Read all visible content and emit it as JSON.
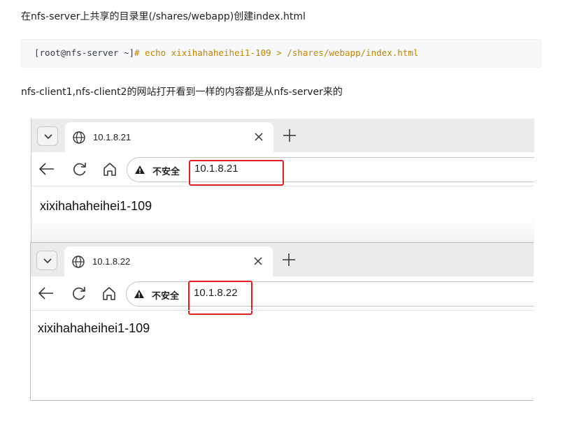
{
  "article": {
    "step_text": "在nfs-server上共享的目录里(/shares/webapp)创建index.html",
    "code_prompt": "[root@nfs-server ~]",
    "code_command": "# echo xixihahaheihei1-109 > /shares/webapp/index.html",
    "result_text": "nfs-client1,nfs-client2的网站打开看到一样的内容都是从nfs-server来的"
  },
  "browsers": [
    {
      "tab_title": "10.1.8.21",
      "security_label": "不安全",
      "url": "10.1.8.21",
      "page_content": "xixihahaheihei1-109"
    },
    {
      "tab_title": "10.1.8.22",
      "security_label": "不安全",
      "url": "10.1.8.22",
      "page_content": "xixihahaheihei1-109"
    }
  ],
  "colors": {
    "highlight": "#e02020",
    "code_command": "#c18401",
    "tabbar": "#ebebeb"
  },
  "icons": [
    "chevron-down-icon",
    "globe-icon",
    "close-icon",
    "plus-icon",
    "back-arrow-icon",
    "reload-icon",
    "home-icon",
    "warning-icon"
  ]
}
